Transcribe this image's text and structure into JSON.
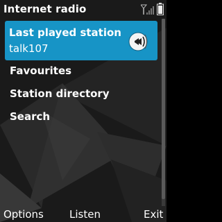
{
  "app": {
    "title": "Internet radio"
  },
  "status": {
    "signal_icon": "signal-icon",
    "battery_icon": "battery-icon"
  },
  "menu": {
    "selected": {
      "label": "Last played station",
      "sublabel": "talk107",
      "icon": "radio-station-icon"
    },
    "items": [
      {
        "label": "Favourites"
      },
      {
        "label": "Station directory"
      },
      {
        "label": "Search"
      }
    ]
  },
  "softkeys": {
    "left": "Options",
    "middle": "Listen",
    "right": "Exit"
  },
  "colors": {
    "highlight": "#1794c6",
    "background": "#1b1b1b",
    "text": "#ffffff"
  }
}
